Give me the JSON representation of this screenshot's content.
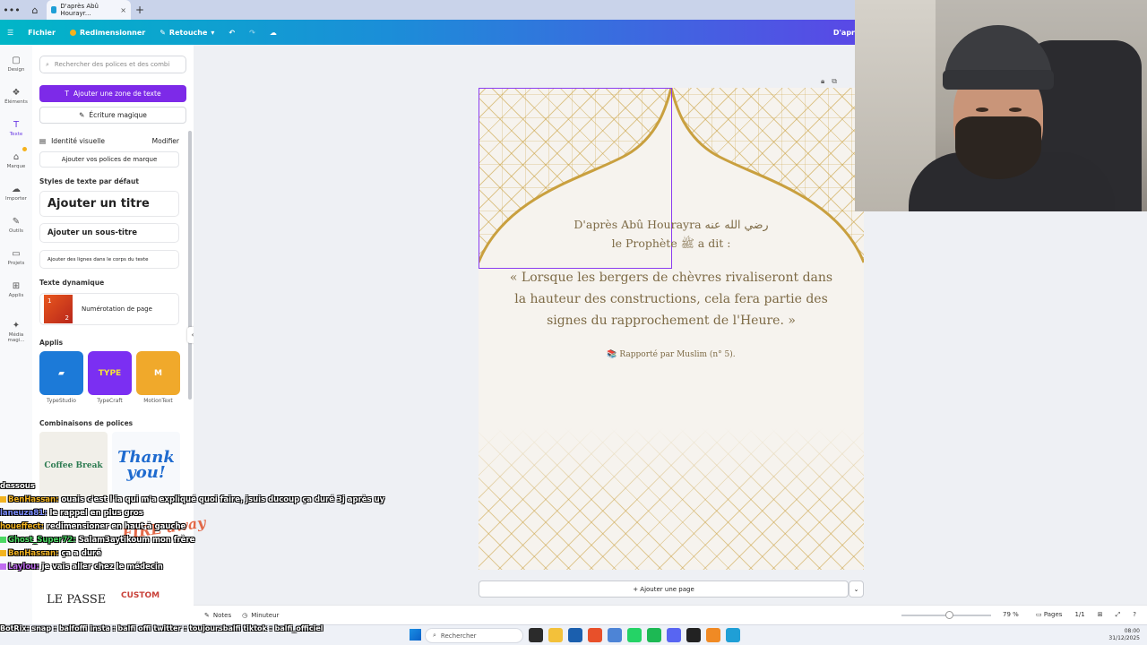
{
  "browser": {
    "tab_title": "D'après Abû Hourayr...",
    "tab_close": "×",
    "new_tab": "+"
  },
  "topbar": {
    "menu": "☰",
    "file": "Fichier",
    "resize": "Redimensionner",
    "retouch": "Retouche",
    "right_text": "D'apr"
  },
  "rail": [
    {
      "label": "Design",
      "icon": "▢"
    },
    {
      "label": "Éléments",
      "icon": "❖"
    },
    {
      "label": "Texte",
      "icon": "T"
    },
    {
      "label": "Marque",
      "icon": "⌂"
    },
    {
      "label": "Importer",
      "icon": "☁"
    },
    {
      "label": "Outils",
      "icon": "✎"
    },
    {
      "label": "Projets",
      "icon": "▭"
    },
    {
      "label": "Applis",
      "icon": "⊞"
    },
    {
      "label": "Média magi...",
      "icon": "✦"
    }
  ],
  "panel": {
    "search_placeholder": "Rechercher des polices et des combi",
    "add_text_box": "Ajouter une zone de texte",
    "magic_write": "Écriture magique",
    "visual_identity": "Identité visuelle",
    "modify": "Modifier",
    "add_brand_fonts": "Ajouter vos polices de marque",
    "default_styles": "Styles de texte par défaut",
    "add_title": "Ajouter un titre",
    "add_subtitle": "Ajouter un sous-titre",
    "add_body": "Ajouter des lignes dans le corps du texte",
    "dynamic_text": "Texte dynamique",
    "page_numbering": "Numérotation de page",
    "apps_title": "Applis",
    "apps": [
      {
        "name": "TypeStudio",
        "color": "#1c7ad8"
      },
      {
        "name": "TypeCraft",
        "color": "#7b2ff2"
      },
      {
        "name": "MotionText",
        "color": "#f0a92b"
      }
    ],
    "font_combos": "Combinaisons de polices",
    "combo1": "Coffee Break",
    "combo2": "Thank you!"
  },
  "page": {
    "heading_line1": "D'après Abû Hourayra رضي الله عنه",
    "heading_line2": "le Prophète ﷺ a dit :",
    "quote": "« Lorsque les bergers de chèvres rivaliseront dans la hauteur des constructions, cela fera partie des signes du rapprochement de l'Heure. »",
    "reference": "📚 Rapporté par Muslim (n° 5).",
    "add_page": "+ Ajouter une page",
    "accent_gold": "#c9a03f"
  },
  "bottombar": {
    "notes": "Notes",
    "timer": "Minuteur",
    "zoom": "79 %",
    "zoom_fraction": 0.5,
    "pages_label": "Pages",
    "page_count": "1/1"
  },
  "chat": [
    {
      "user": "",
      "message": "dessous",
      "color": "#ffffff"
    },
    {
      "user": "BenHassan:",
      "message": "ouais c'est l'ia qui m'a expliqué quoi faire, jsuis ducoup ça duré 3j après uy",
      "color": "#f2b320"
    },
    {
      "user": "laneuza81:",
      "message": "le rappel en plus gros",
      "color": "#7a8cff"
    },
    {
      "user": "houeffect:",
      "message": "redimensioner en haut à gauche",
      "color": "#f2b320"
    },
    {
      "user": "Ghost_Super72:",
      "message": "Salam3aytikoum mon frère",
      "color": "#4cd964"
    },
    {
      "user": "BenHassan:",
      "message": "ça a duré",
      "color": "#f2b320"
    },
    {
      "user": "Laylou:",
      "message": "je vais aller chez le médecin",
      "color": "#c06cf0"
    }
  ],
  "chat_bottom": "BotRix: snap : balfoffi insta : balfi offi twitter : toujoursbalfi tiktok : balfi_officiel",
  "overlay": {
    "fire": "FIRE away",
    "passe": "LE PASSE",
    "custom": "CUSTOM"
  },
  "taskbar": {
    "search": "Rechercher",
    "time": "08:00",
    "date": "31/12/2025"
  }
}
